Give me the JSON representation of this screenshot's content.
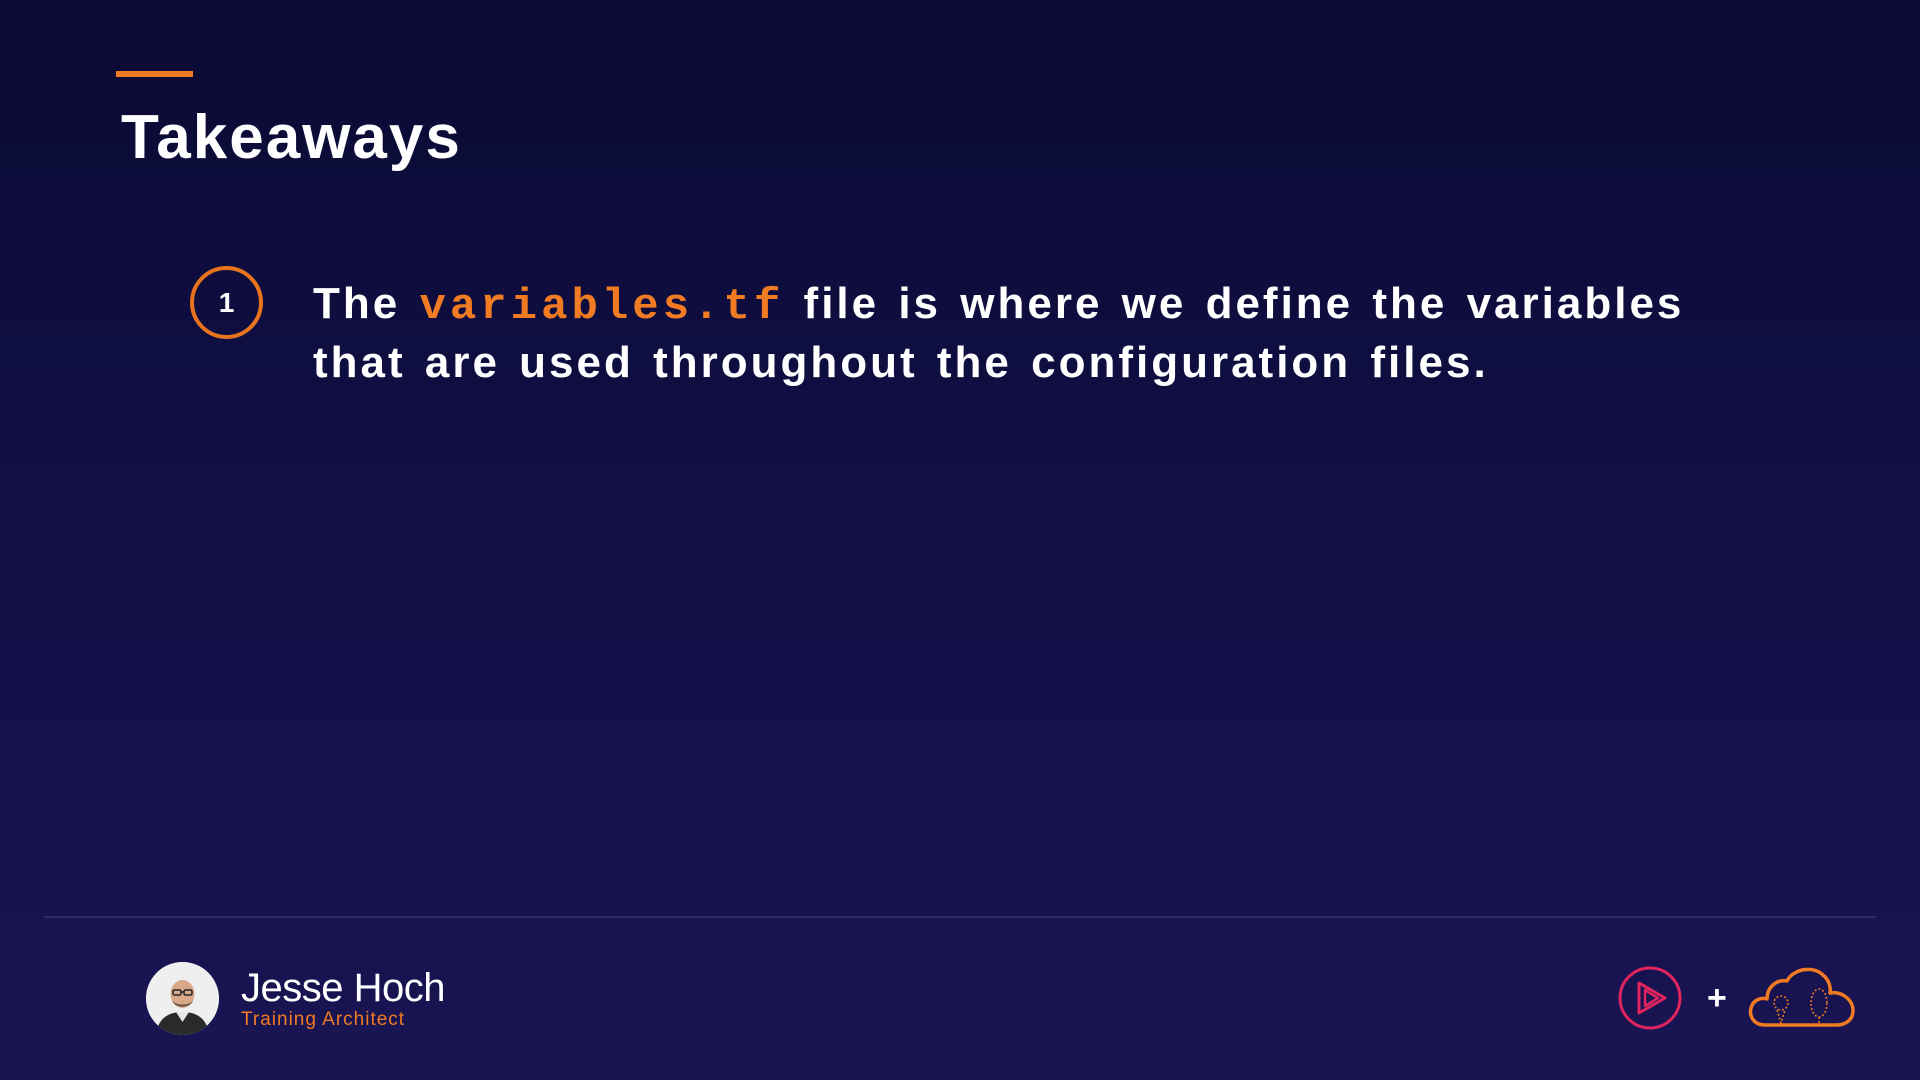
{
  "slide": {
    "title": "Takeaways",
    "accent_color": "#f07b22"
  },
  "takeaways": [
    {
      "number": "1",
      "text_before": "The ",
      "code": "variables.tf",
      "text_after": " file is where we define the variables that are used throughout the configuration files."
    }
  ],
  "presenter": {
    "name": "Jesse Hoch",
    "role": "Training Architect"
  },
  "logos": {
    "play_logo_icon": "play-logo-icon",
    "plus": "+",
    "cloud_logo_icon": "cloud-logo-icon"
  }
}
